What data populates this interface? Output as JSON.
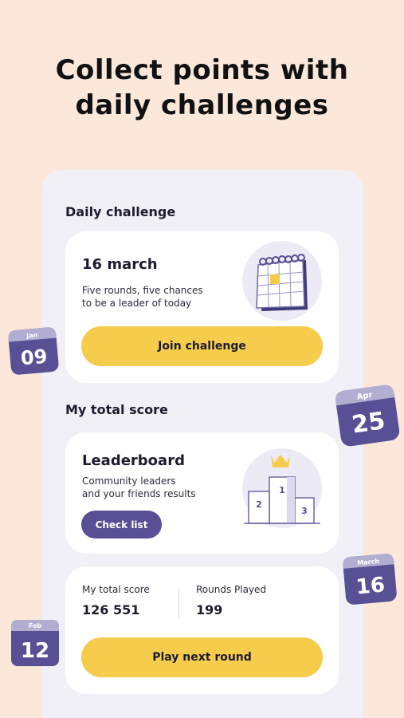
{
  "headline": {
    "line1": "Collect points with",
    "line2": "daily challenges"
  },
  "daily_challenge": {
    "section_title": "Daily challenge",
    "date": "16 march",
    "desc_line1": "Five rounds, five chances",
    "desc_line2": "to be a leader of today",
    "join_button": "Join challenge"
  },
  "total_score_section": {
    "section_title": "My total score"
  },
  "leaderboard": {
    "title": "Leaderboard",
    "desc_line1": "Community leaders",
    "desc_line2": "and your friends results",
    "button": "Check list",
    "podium": [
      "1",
      "2",
      "3"
    ]
  },
  "score": {
    "total_label": "My total score",
    "total_value": "126 551",
    "rounds_label": "Rounds Played",
    "rounds_value": "199",
    "play_button": "Play next round"
  },
  "badges": [
    {
      "month": "Jan",
      "day": "09"
    },
    {
      "month": "Apr",
      "day": "25"
    },
    {
      "month": "March",
      "day": "16"
    },
    {
      "month": "Feb",
      "day": "12"
    }
  ],
  "colors": {
    "background": "#fbe8db",
    "panel": "#f1f0f7",
    "accent_yellow": "#f6cc4c",
    "accent_purple": "#575095"
  }
}
